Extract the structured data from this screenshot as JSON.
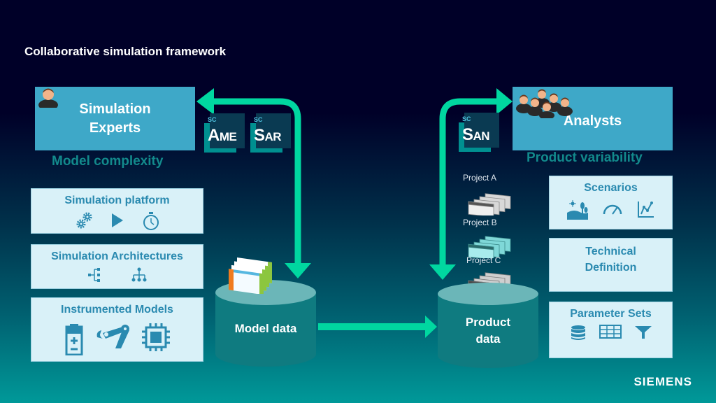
{
  "title": "Collaborative simulation framework",
  "colors": {
    "background_top": "#000028",
    "background_bottom": "#009999",
    "arrow": "#00d7a0",
    "role_box": "#3ea8c8",
    "caption": "#128a8c",
    "feature_box": "#d9f1f8",
    "feature_text": "#2a8ab0",
    "cylinder": "#0f7b80",
    "cylinder_top": "#6bb6b8"
  },
  "left": {
    "role": {
      "label": "Simulation Experts",
      "icon": "single-user-icon"
    },
    "caption": "Model complexity",
    "badges": [
      {
        "prefix": "SC",
        "letter": "A",
        "suffix": "ME"
      },
      {
        "prefix": "SC",
        "letter": "S",
        "suffix": "AR"
      }
    ],
    "features": [
      {
        "title": "Simulation platform",
        "icons": [
          "gears-icon",
          "play-icon",
          "stopwatch-icon"
        ]
      },
      {
        "title": "Simulation Architectures",
        "icons": [
          "tree-left-icon",
          "hierarchy-icon"
        ]
      },
      {
        "title": "Instrumented Models",
        "icons": [
          "battery-icon",
          "robot-arm-icon",
          "chip-icon"
        ]
      }
    ],
    "store": {
      "label": "Model data",
      "icon": "model-documents-icon"
    }
  },
  "right": {
    "role": {
      "label": "Analysts",
      "icon": "user-group-icon"
    },
    "caption": "Product variability",
    "badges": [
      {
        "prefix": "SC",
        "letter": "S",
        "suffix": "AN"
      }
    ],
    "projects": [
      "Project A",
      "Project B",
      "Project C"
    ],
    "features": [
      {
        "title": "Scenarios",
        "icons": [
          "landscape-icon",
          "gauge-icon",
          "line-chart-icon"
        ]
      },
      {
        "title": "Technical Definition",
        "icons": []
      },
      {
        "title": "Parameter Sets",
        "icons": [
          "database-icon",
          "table-icon",
          "filter-icon"
        ]
      }
    ],
    "store": {
      "label_line1": "Product",
      "label_line2": "data"
    }
  },
  "brand": "SIEMENS"
}
